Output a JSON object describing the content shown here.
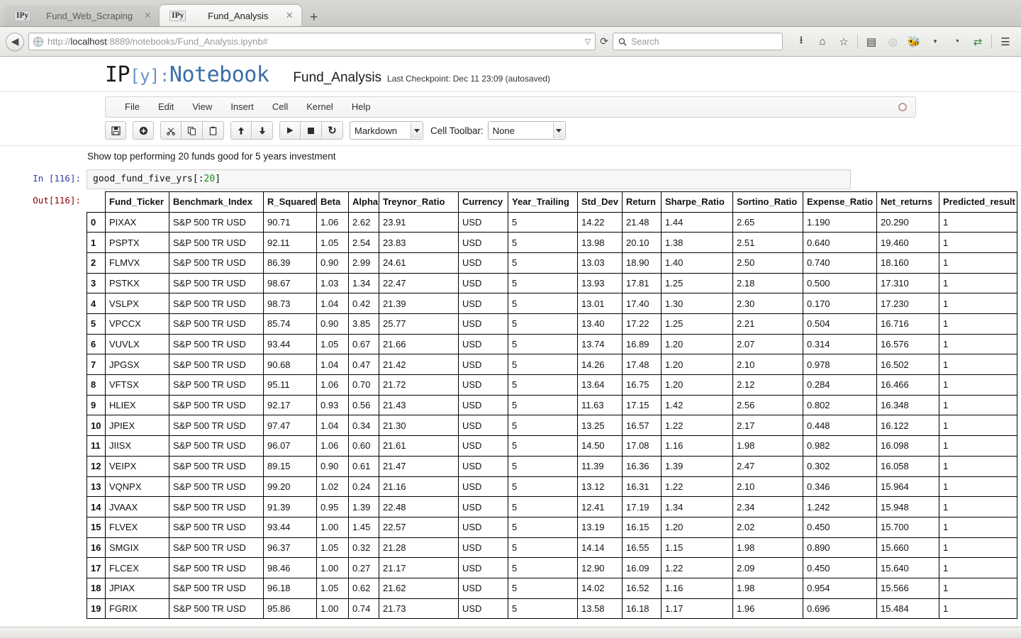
{
  "browser": {
    "tabs": [
      {
        "favicon": "IPy",
        "title": "Fund_Web_Scraping",
        "close": "✕",
        "active": false
      },
      {
        "favicon": "IPy",
        "title": "Fund_Analysis",
        "close": "✕",
        "active": true
      }
    ],
    "new_tab_label": "+",
    "back_label": "◀",
    "url": "http://localhost:8889/notebooks/Fund_Analysis.ipynb#",
    "url_host": "localhost",
    "url_prefix": "http://",
    "url_suffix": ":8889/notebooks/Fund_Analysis.ipynb#",
    "url_dropdown": "▽",
    "reload_label": "⟳",
    "search_placeholder": "Search",
    "search_value": "",
    "nav_icons": [
      {
        "name": "downloads-icon",
        "glyph": "⭳"
      },
      {
        "name": "home-icon",
        "glyph": "⌂"
      },
      {
        "name": "bookmark-star-icon",
        "glyph": "☆"
      },
      {
        "name": "reading-list-icon",
        "glyph": "▤"
      },
      {
        "name": "pocket-icon",
        "glyph": "◎"
      },
      {
        "name": "extension-icon",
        "glyph": "🐝"
      },
      {
        "name": "extension-dropdown-icon",
        "glyph": "▾"
      },
      {
        "name": "history-icon",
        "glyph": "◔"
      },
      {
        "name": "sync-arrows-icon",
        "glyph": "⇄"
      },
      {
        "name": "menu-hamburger-icon",
        "glyph": "☰"
      }
    ]
  },
  "notebook": {
    "logo_ip": "IP",
    "logo_y": "[y]:",
    "logo_nb": "Notebook",
    "name": "Fund_Analysis",
    "checkpoint": "Last Checkpoint: Dec 11 23:09 (autosaved)",
    "menu": [
      "File",
      "Edit",
      "View",
      "Insert",
      "Cell",
      "Kernel",
      "Help"
    ],
    "toolbar": {
      "buttons": [
        {
          "name": "save-button",
          "glyph": "💾"
        },
        {
          "name": "insert-cell-below-button",
          "glyph": "⊕"
        },
        {
          "name": "cut-cell-button",
          "glyph": "✂"
        },
        {
          "name": "copy-cell-button",
          "glyph": "⧉"
        },
        {
          "name": "paste-cell-button",
          "glyph": "📋"
        },
        {
          "name": "move-cell-up-button",
          "glyph": "↑"
        },
        {
          "name": "move-cell-down-button",
          "glyph": "↓"
        },
        {
          "name": "run-cell-button",
          "glyph": "▶"
        },
        {
          "name": "interrupt-kernel-button",
          "glyph": "■"
        },
        {
          "name": "restart-kernel-button",
          "glyph": "⟳"
        }
      ],
      "cell_type_value": "Markdown",
      "cell_toolbar_label": "Cell Toolbar:",
      "cell_toolbar_value": "None"
    }
  },
  "cells": {
    "markdown_text": "Show top performing 20 funds good for 5 years investment",
    "in_prompt": "In [116]:",
    "out_prompt": "Out[116]:",
    "code_before": "good_fund_five_yrs[:",
    "code_number": "20",
    "code_after": "]"
  },
  "table": {
    "index_header": "",
    "columns": [
      "Fund_Ticker",
      "Benchmark_Index",
      "R_Squared",
      "Beta",
      "Alpha",
      "Treynor_Ratio",
      "Currency",
      "Year_Trailing",
      "Std_Dev",
      "Return",
      "Sharpe_Ratio",
      "Sortino_Ratio",
      "Expense_Ratio",
      "Net_returns",
      "Predicted_result"
    ],
    "rows": [
      {
        "index": "0",
        "cells": [
          "PIXAX",
          "S&P 500 TR USD",
          "90.71",
          "1.06",
          "2.62",
          "23.91",
          "USD",
          "5",
          "14.22",
          "21.48",
          "1.44",
          "2.65",
          "1.190",
          "20.290",
          "1"
        ]
      },
      {
        "index": "1",
        "cells": [
          "PSPTX",
          "S&P 500 TR USD",
          "92.11",
          "1.05",
          "2.54",
          "23.83",
          "USD",
          "5",
          "13.98",
          "20.10",
          "1.38",
          "2.51",
          "0.640",
          "19.460",
          "1"
        ]
      },
      {
        "index": "2",
        "cells": [
          "FLMVX",
          "S&P 500 TR USD",
          "86.39",
          "0.90",
          "2.99",
          "24.61",
          "USD",
          "5",
          "13.03",
          "18.90",
          "1.40",
          "2.50",
          "0.740",
          "18.160",
          "1"
        ]
      },
      {
        "index": "3",
        "cells": [
          "PSTKX",
          "S&P 500 TR USD",
          "98.67",
          "1.03",
          "1.34",
          "22.47",
          "USD",
          "5",
          "13.93",
          "17.81",
          "1.25",
          "2.18",
          "0.500",
          "17.310",
          "1"
        ]
      },
      {
        "index": "4",
        "cells": [
          "VSLPX",
          "S&P 500 TR USD",
          "98.73",
          "1.04",
          "0.42",
          "21.39",
          "USD",
          "5",
          "13.01",
          "17.40",
          "1.30",
          "2.30",
          "0.170",
          "17.230",
          "1"
        ]
      },
      {
        "index": "5",
        "cells": [
          "VPCCX",
          "S&P 500 TR USD",
          "85.74",
          "0.90",
          "3.85",
          "25.77",
          "USD",
          "5",
          "13.40",
          "17.22",
          "1.25",
          "2.21",
          "0.504",
          "16.716",
          "1"
        ]
      },
      {
        "index": "6",
        "cells": [
          "VUVLX",
          "S&P 500 TR USD",
          "93.44",
          "1.05",
          "0.67",
          "21.66",
          "USD",
          "5",
          "13.74",
          "16.89",
          "1.20",
          "2.07",
          "0.314",
          "16.576",
          "1"
        ]
      },
      {
        "index": "7",
        "cells": [
          "JPGSX",
          "S&P 500 TR USD",
          "90.68",
          "1.04",
          "0.47",
          "21.42",
          "USD",
          "5",
          "14.26",
          "17.48",
          "1.20",
          "2.10",
          "0.978",
          "16.502",
          "1"
        ]
      },
      {
        "index": "8",
        "cells": [
          "VFTSX",
          "S&P 500 TR USD",
          "95.11",
          "1.06",
          "0.70",
          "21.72",
          "USD",
          "5",
          "13.64",
          "16.75",
          "1.20",
          "2.12",
          "0.284",
          "16.466",
          "1"
        ]
      },
      {
        "index": "9",
        "cells": [
          "HLIEX",
          "S&P 500 TR USD",
          "92.17",
          "0.93",
          "0.56",
          "21.43",
          "USD",
          "5",
          "11.63",
          "17.15",
          "1.42",
          "2.56",
          "0.802",
          "16.348",
          "1"
        ]
      },
      {
        "index": "10",
        "cells": [
          "JPIEX",
          "S&P 500 TR USD",
          "97.47",
          "1.04",
          "0.34",
          "21.30",
          "USD",
          "5",
          "13.25",
          "16.57",
          "1.22",
          "2.17",
          "0.448",
          "16.122",
          "1"
        ]
      },
      {
        "index": "11",
        "cells": [
          "JIISX",
          "S&P 500 TR USD",
          "96.07",
          "1.06",
          "0.60",
          "21.61",
          "USD",
          "5",
          "14.50",
          "17.08",
          "1.16",
          "1.98",
          "0.982",
          "16.098",
          "1"
        ]
      },
      {
        "index": "12",
        "cells": [
          "VEIPX",
          "S&P 500 TR USD",
          "89.15",
          "0.90",
          "0.61",
          "21.47",
          "USD",
          "5",
          "11.39",
          "16.36",
          "1.39",
          "2.47",
          "0.302",
          "16.058",
          "1"
        ]
      },
      {
        "index": "13",
        "cells": [
          "VQNPX",
          "S&P 500 TR USD",
          "99.20",
          "1.02",
          "0.24",
          "21.16",
          "USD",
          "5",
          "13.12",
          "16.31",
          "1.22",
          "2.10",
          "0.346",
          "15.964",
          "1"
        ]
      },
      {
        "index": "14",
        "cells": [
          "JVAAX",
          "S&P 500 TR USD",
          "91.39",
          "0.95",
          "1.39",
          "22.48",
          "USD",
          "5",
          "12.41",
          "17.19",
          "1.34",
          "2.34",
          "1.242",
          "15.948",
          "1"
        ]
      },
      {
        "index": "15",
        "cells": [
          "FLVEX",
          "S&P 500 TR USD",
          "93.44",
          "1.00",
          "1.45",
          "22.57",
          "USD",
          "5",
          "13.19",
          "16.15",
          "1.20",
          "2.02",
          "0.450",
          "15.700",
          "1"
        ]
      },
      {
        "index": "16",
        "cells": [
          "SMGIX",
          "S&P 500 TR USD",
          "96.37",
          "1.05",
          "0.32",
          "21.28",
          "USD",
          "5",
          "14.14",
          "16.55",
          "1.15",
          "1.98",
          "0.890",
          "15.660",
          "1"
        ]
      },
      {
        "index": "17",
        "cells": [
          "FLCEX",
          "S&P 500 TR USD",
          "98.46",
          "1.00",
          "0.27",
          "21.17",
          "USD",
          "5",
          "12.90",
          "16.09",
          "1.22",
          "2.09",
          "0.450",
          "15.640",
          "1"
        ]
      },
      {
        "index": "18",
        "cells": [
          "JPIAX",
          "S&P 500 TR USD",
          "96.18",
          "1.05",
          "0.62",
          "21.62",
          "USD",
          "5",
          "14.02",
          "16.52",
          "1.16",
          "1.98",
          "0.954",
          "15.566",
          "1"
        ]
      },
      {
        "index": "19",
        "cells": [
          "FGRIX",
          "S&P 500 TR USD",
          "95.86",
          "1.00",
          "0.74",
          "21.73",
          "USD",
          "5",
          "13.58",
          "16.18",
          "1.17",
          "1.96",
          "0.696",
          "15.484",
          "1"
        ]
      }
    ]
  }
}
